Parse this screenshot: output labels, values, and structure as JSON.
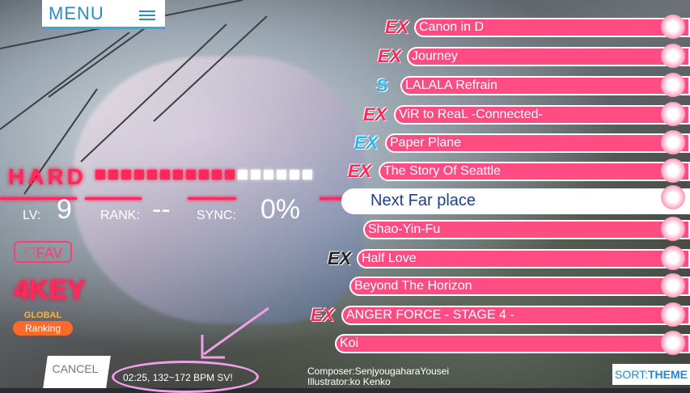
{
  "menu": {
    "label": "MENU"
  },
  "difficulty": {
    "label": "HARD",
    "gauge_total": 17,
    "gauge_filled": 11
  },
  "stats": {
    "lv_label": "LV:",
    "lv_value": "9",
    "rank_label": "RANK:",
    "rank_value": "--",
    "sync_label": "SYNC:",
    "sync_value": "0%"
  },
  "fav": {
    "label": "♡FAV"
  },
  "mode": {
    "label": "4KEY"
  },
  "global": {
    "line1": "GLOBAL",
    "line2": "Ranking"
  },
  "cancel": {
    "label": "CANCEL"
  },
  "bpm_info": "02:25, 132~172 BPM SV!",
  "composer": {
    "line1": "Composer:SenjyougaharaYousei",
    "line2": "Illustrator:ko Kenko"
  },
  "sort": {
    "prefix": "SORT:",
    "value": "THEME"
  },
  "songs": [
    {
      "title": "Canon in D",
      "badge": "EX",
      "badge_style": "ex"
    },
    {
      "title": "Journey",
      "badge": "EX",
      "badge_style": "ex"
    },
    {
      "title": "LALALA Refrain",
      "badge": "S",
      "badge_style": "s"
    },
    {
      "title": "ViR to ReaL -Connected-",
      "badge": "EX",
      "badge_style": "ex"
    },
    {
      "title": "Paper Plane",
      "badge": "EX",
      "badge_style": "ex-blue"
    },
    {
      "title": "The Story Of Seattle",
      "badge": "EX",
      "badge_style": "ex"
    },
    {
      "title": "Next Far place",
      "badge": "",
      "badge_style": ""
    },
    {
      "title": "Shao-Yin-Fu",
      "badge": "",
      "badge_style": ""
    },
    {
      "title": "Half Love",
      "badge": "EX",
      "badge_style": "ex-dark"
    },
    {
      "title": "Beyond The Horizon",
      "badge": "",
      "badge_style": ""
    },
    {
      "title": "ANGER FORCE - STAGE 4 -",
      "badge": "EX",
      "badge_style": "ex"
    },
    {
      "title": "Koi",
      "badge": "",
      "badge_style": ""
    }
  ],
  "selected_index": 6,
  "colors": {
    "accent": "#ff4d84",
    "highlight": "#ff2a5a",
    "blue": "#2d89c7"
  }
}
